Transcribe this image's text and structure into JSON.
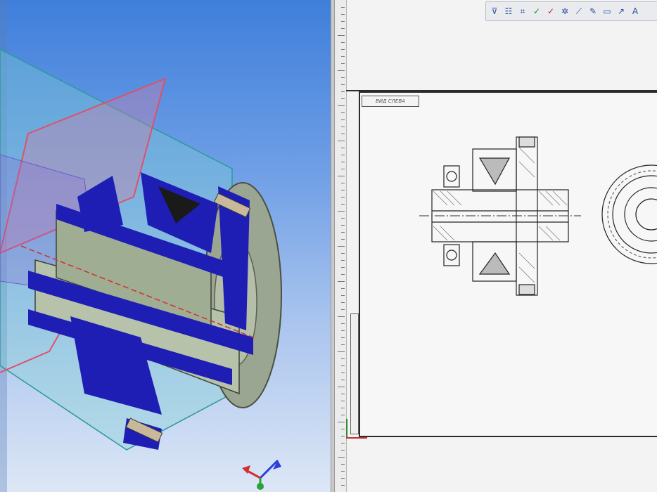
{
  "window": {
    "split_layout": "3D model viewport left, 2D drawing sheet right"
  },
  "model_view": {
    "background_colors": [
      "#3f7fdb",
      "#dde7f6"
    ],
    "section_color": "#1e1eb4",
    "body_color": "#a7b39c",
    "plane_color": "#e0506a",
    "axis_triad": {
      "x_color": "#d33030",
      "y_color": "#2aa03a",
      "z_color": "#2b3fd8"
    }
  },
  "drawing_view": {
    "view_label": "ВИД СЛЕВА",
    "toolbar": {
      "icons": [
        "filter-icon",
        "layers-icon",
        "snap-icon",
        "check-icon",
        "check-red-icon",
        "settings-icon",
        "line-icon",
        "pen-icon",
        "rect-icon",
        "arrow-icon",
        "text-icon"
      ]
    },
    "frame_color": "#2b2b2b"
  }
}
